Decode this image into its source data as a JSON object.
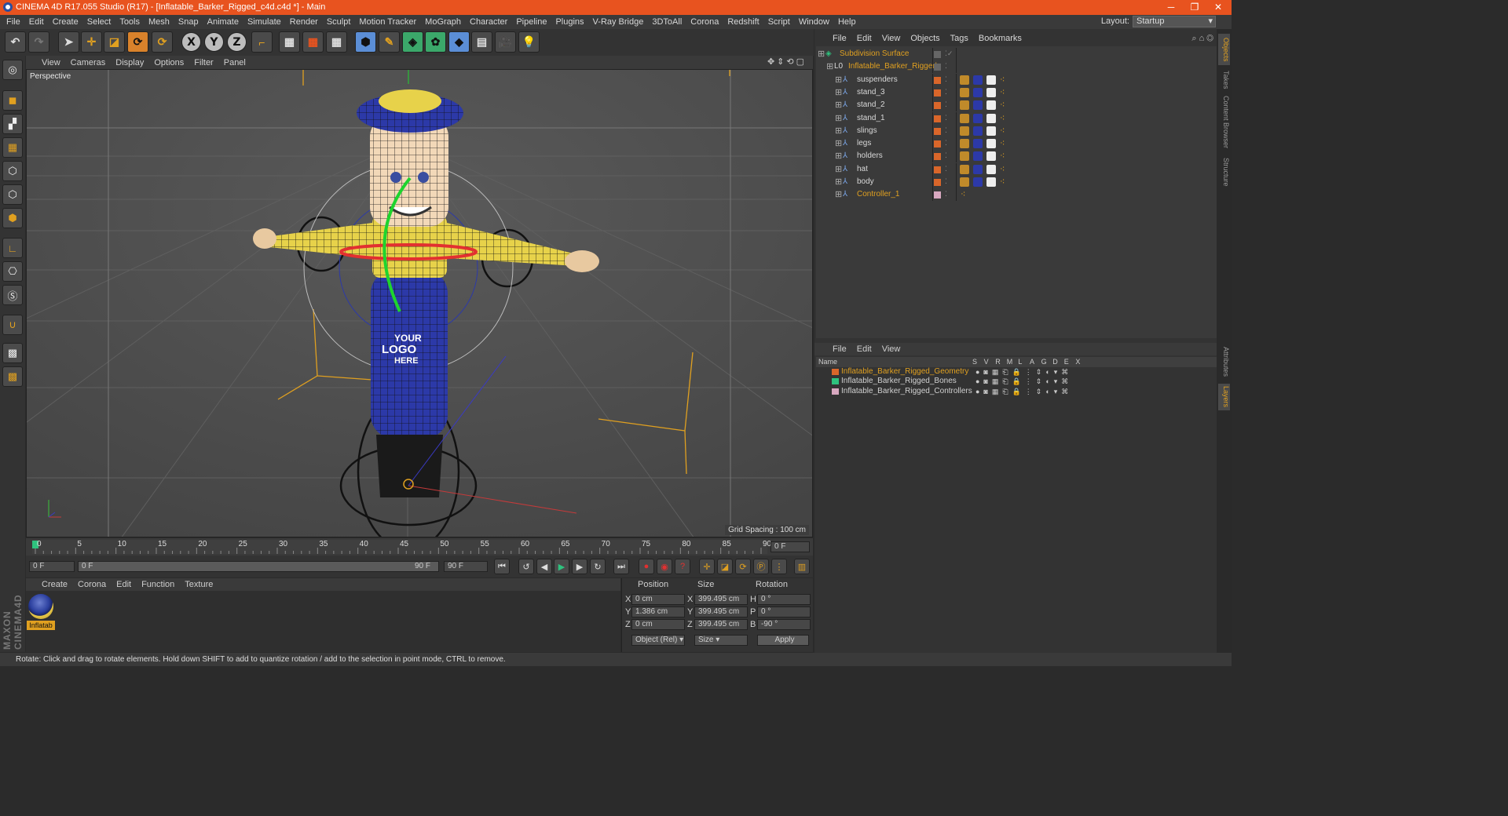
{
  "title": "CINEMA 4D R17.055 Studio (R17) - [Inflatable_Barker_Rigged_c4d.c4d *] - Main",
  "window_controls": [
    "─",
    "❐",
    "✕"
  ],
  "menu": [
    "File",
    "Edit",
    "Create",
    "Select",
    "Tools",
    "Mesh",
    "Snap",
    "Animate",
    "Simulate",
    "Render",
    "Sculpt",
    "Motion Tracker",
    "MoGraph",
    "Character",
    "Pipeline",
    "Plugins",
    "V-Ray Bridge",
    "3DToAll",
    "Corona",
    "Redshift",
    "Script",
    "Window",
    "Help"
  ],
  "layout": {
    "label": "Layout:",
    "value": "Startup"
  },
  "toolbar_axes": [
    "X",
    "Y",
    "Z"
  ],
  "viewport": {
    "menu": [
      "View",
      "Cameras",
      "Display",
      "Options",
      "Filter",
      "Panel"
    ],
    "label": "Perspective",
    "grid_spacing": "Grid Spacing : 100 cm",
    "logo_text": [
      "YOUR",
      "LOGO",
      "HERE"
    ]
  },
  "timeline": {
    "ticks": [
      "0",
      "5",
      "10",
      "15",
      "20",
      "25",
      "30",
      "35",
      "40",
      "45",
      "50",
      "55",
      "60",
      "65",
      "70",
      "75",
      "80",
      "85",
      "90"
    ],
    "current_frame": "0 F",
    "start": "0 F",
    "slider_start": "0 F",
    "slider_end": "90 F",
    "end": "90 F"
  },
  "material_manager": {
    "menu": [
      "Create",
      "Corona",
      "Edit",
      "Function",
      "Texture"
    ],
    "material_name": "Inflatab"
  },
  "maxon_logo": "MAXON CINEMA4D",
  "coords": {
    "headers": [
      "Position",
      "Size",
      "Rotation"
    ],
    "rows": [
      {
        "axis": "X",
        "pos": "0 cm",
        "size_axis": "X",
        "size": "399.495 cm",
        "rot_axis": "H",
        "rot": "0 °"
      },
      {
        "axis": "Y",
        "pos": "1.386 cm",
        "size_axis": "Y",
        "size": "399.495 cm",
        "rot_axis": "P",
        "rot": "0 °"
      },
      {
        "axis": "Z",
        "pos": "0 cm",
        "size_axis": "Z",
        "size": "399.495 cm",
        "rot_axis": "B",
        "rot": "-90 °"
      }
    ],
    "mode": "Object (Rel)",
    "size_mode": "Size",
    "apply": "Apply"
  },
  "object_manager": {
    "menu": [
      "File",
      "Edit",
      "View",
      "Objects",
      "Tags",
      "Bookmarks"
    ],
    "objects": [
      {
        "name": "Subdivision Surface",
        "level": 0
      },
      {
        "name": "Inflatable_Barker_Rigged",
        "level": 1
      },
      {
        "name": "suspenders",
        "level": 2
      },
      {
        "name": "stand_3",
        "level": 2
      },
      {
        "name": "stand_2",
        "level": 2
      },
      {
        "name": "stand_1",
        "level": 2
      },
      {
        "name": "slings",
        "level": 2
      },
      {
        "name": "legs",
        "level": 2
      },
      {
        "name": "holders",
        "level": 2
      },
      {
        "name": "hat",
        "level": 2
      },
      {
        "name": "body",
        "level": 2
      },
      {
        "name": "Controller_1",
        "level": 2
      }
    ]
  },
  "layer_manager": {
    "menu": [
      "File",
      "Edit",
      "View"
    ],
    "header": "Name",
    "columns": [
      "S",
      "V",
      "R",
      "M",
      "L",
      "A",
      "G",
      "D",
      "E",
      "X"
    ],
    "layers": [
      {
        "name": "Inflatable_Barker_Rigged_Geometry",
        "color": "#d9662a"
      },
      {
        "name": "Inflatable_Barker_Rigged_Bones",
        "color": "#2ec27e"
      },
      {
        "name": "Inflatable_Barker_Rigged_Controllers",
        "color": "#d8a8c0"
      }
    ]
  },
  "side_tabs": [
    "Objects",
    "Takes",
    "Content Browser",
    "Structure",
    "Attributes",
    "Layers"
  ],
  "status": "Rotate: Click and drag to rotate elements. Hold down SHIFT to add to quantize rotation / add to the selection in point mode, CTRL to remove.",
  "colors": {
    "accent": "#e8531f",
    "object_orange": "#e0a020",
    "hat_blue": "#2c39a8",
    "body_yellow": "#e7d24a"
  }
}
